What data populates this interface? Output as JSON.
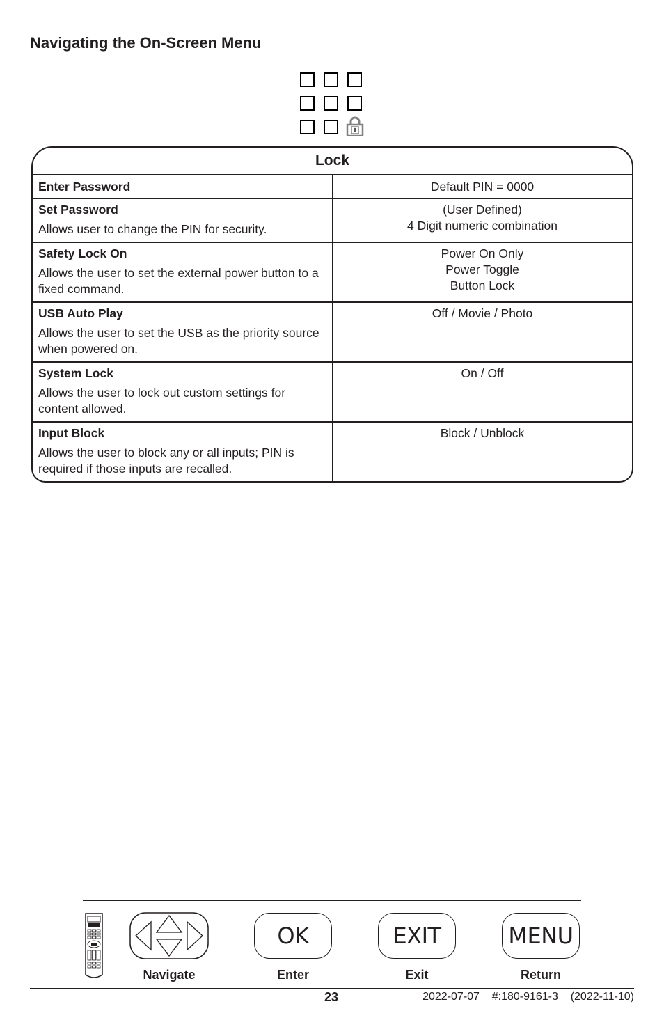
{
  "page": {
    "section_title": "Navigating the On-Screen Menu"
  },
  "menu_icon": {
    "name": "lock-menu-grid-icon",
    "grid": 3,
    "highlighted_cell": "lock-icon",
    "highlight_color": "#808080"
  },
  "lock_table": {
    "title": "Lock",
    "rows": [
      {
        "name": "Enter Password",
        "description": "",
        "options": [
          "Default PIN = 0000"
        ]
      },
      {
        "name": "Set Password",
        "description": "Allows user to change the PIN for security.",
        "options": [
          "(User Defined)",
          "4 Digit numeric combination"
        ]
      },
      {
        "name": "Safety Lock On",
        "description": "Allows the user to set the external power button to a fixed command.",
        "options": [
          "Power On Only",
          "Power Toggle",
          "Button Lock"
        ]
      },
      {
        "name": "USB Auto Play",
        "description": "Allows the user to set the USB as the priority source when powered on.",
        "options": [
          "Off / Movie / Photo"
        ]
      },
      {
        "name": "System Lock",
        "description": "Allows the user to lock out custom settings for content allowed.",
        "options": [
          "On / Off"
        ]
      },
      {
        "name": "Input Block",
        "description": "Allows the user to block any or all inputs; PIN is required if those inputs are recalled.",
        "options": [
          "Block  / Unblock"
        ]
      }
    ]
  },
  "remote_legend": {
    "keys": [
      {
        "key_label": "",
        "icon": "navigate-arrows-icon",
        "caption": "Navigate"
      },
      {
        "key_label": "OK",
        "caption": "Enter"
      },
      {
        "key_label": "EXIT",
        "caption": "Exit"
      },
      {
        "key_label": "MENU",
        "caption": "Return"
      }
    ]
  },
  "footer": {
    "page_number": "23",
    "doc_meta": "2022-07-07    #:180-9161-3    (2022-11-10)"
  }
}
